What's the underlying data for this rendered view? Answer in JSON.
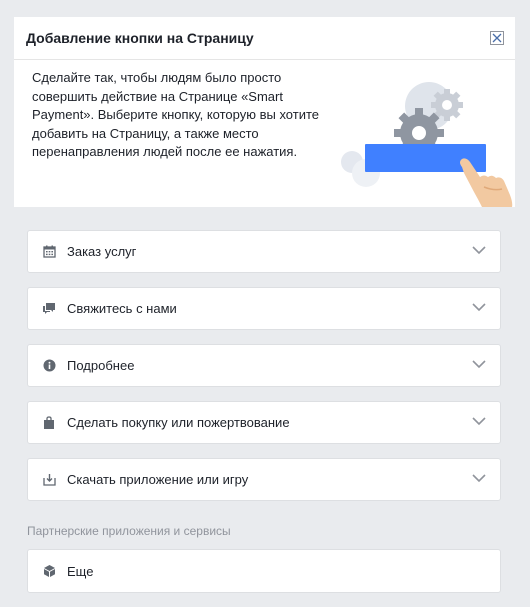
{
  "dialog": {
    "title": "Добавление кнопки на Страницу",
    "intro": "Сделайте так, чтобы людям было просто совершить действие на Странице «Smart Payment». Выберите кнопку, которую вы хотите добавить на Страницу, а также место перенаправления людей после ее нажатия."
  },
  "options": [
    {
      "label": "Заказ услуг",
      "icon": "calendar-icon"
    },
    {
      "label": "Свяжитесь с нами",
      "icon": "chat-icon"
    },
    {
      "label": "Подробнее",
      "icon": "info-icon"
    },
    {
      "label": "Сделать покупку или пожертвование",
      "icon": "shopping-bag-icon"
    },
    {
      "label": "Скачать приложение или игру",
      "icon": "download-icon"
    }
  ],
  "partners": {
    "section_label": "Партнерские приложения и сервисы",
    "more_label": "Еще",
    "more_icon": "cube-icon"
  },
  "colors": {
    "accent_blue": "#4080ff",
    "background": "#e9ebee"
  }
}
